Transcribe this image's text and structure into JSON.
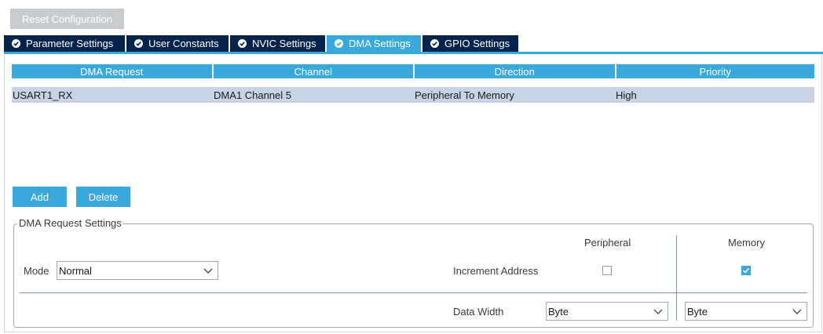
{
  "toolbar": {
    "reset_label": "Reset Configuration"
  },
  "tabs": [
    {
      "label": "Parameter Settings",
      "active": false
    },
    {
      "label": "User Constants",
      "active": false
    },
    {
      "label": "NVIC Settings",
      "active": false
    },
    {
      "label": "DMA Settings",
      "active": true
    },
    {
      "label": "GPIO Settings",
      "active": false
    }
  ],
  "table": {
    "columns": [
      "DMA Request",
      "Channel",
      "Direction",
      "Priority"
    ],
    "rows": [
      [
        "USART1_RX",
        "DMA1 Channel 5",
        "Peripheral To Memory",
        "High"
      ]
    ]
  },
  "actions": {
    "add_label": "Add",
    "delete_label": "Delete"
  },
  "settings": {
    "legend": "DMA Request Settings",
    "mode_label": "Mode",
    "mode_value": "Normal",
    "peripheral_header": "Peripheral",
    "memory_header": "Memory",
    "increment_label": "Increment Address",
    "increment_peripheral": false,
    "increment_memory": true,
    "data_width_label": "Data Width",
    "data_width_peripheral": "Byte",
    "data_width_memory": "Byte"
  },
  "colors": {
    "accent": "#39a9dc",
    "tab_dark": "#03234b",
    "row_selected": "#c6d4e6",
    "disabled": "#c9ccce"
  }
}
